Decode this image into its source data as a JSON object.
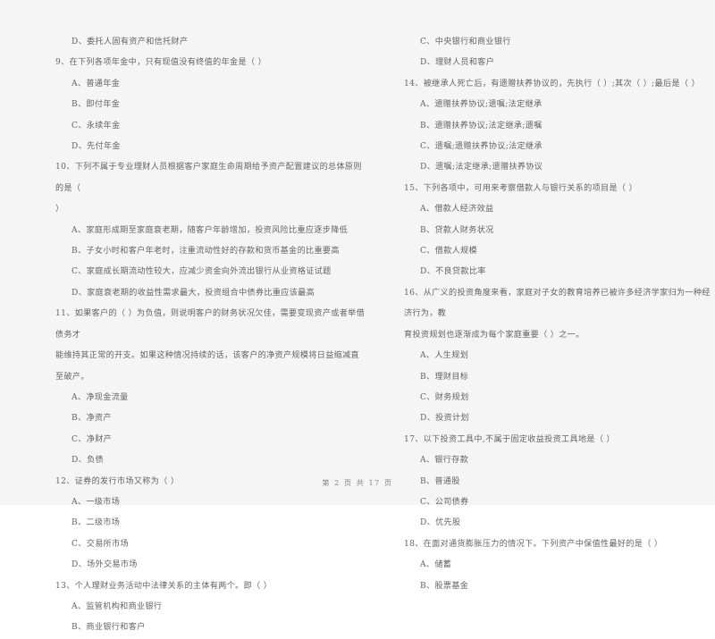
{
  "document": {
    "type": "scanned-exam-paper",
    "subject_hint": "银行从业资格证试题",
    "footer": "第 2 页  共 17 页",
    "ink_color": "#63615f",
    "paper_color": "#fefefe"
  },
  "columns": {
    "left": [
      {
        "kind": "option",
        "text": "D、委托人固有资产和信托财产"
      },
      {
        "kind": "question",
        "number": "9",
        "stem": "9、在下列各项年金中，只有现值没有终值的年金是（      ）",
        "options": [
          "A、普通年金",
          "B、即付年金",
          "C、永续年金",
          "D、先付年金"
        ]
      },
      {
        "kind": "question",
        "number": "10",
        "stem": "10、下列不属于专业理财人员根据客户家庭生命周期给予资产配置建议的总体原则的是（",
        "stem_cont": "）",
        "options": [
          "A、家庭形成期至家庭衰老期，随客户年龄增加，投资风险比重应逐步降低",
          "B、子女小时和客户年老时，注重流动性好的存款和货币基金的比重要高",
          "C、家庭成长期流动性较大，应减少资金向外流出银行从业资格证试题",
          "D、家庭衰老期的收益性需求最大，投资组合中债券比重应该最高"
        ]
      },
      {
        "kind": "question",
        "number": "11",
        "stem": "11、如果客户的（      ）为负值，则说明客户的财务状况欠佳，需要变现资产或者举借债务才",
        "stem_cont": "能维持其正常的开支。如果这种情况持续的话，该客户的净资产规模将日益缩减直至破产。",
        "options": [
          "A、净现金流量",
          "B、净资产",
          "C、净财产",
          "D、负债"
        ]
      },
      {
        "kind": "question",
        "number": "12",
        "stem": "12、证券的发行市场又称为（      ）",
        "options": [
          "A、一级市场",
          "B、二级市场",
          "C、交易所市场",
          "D、场外交易市场"
        ]
      },
      {
        "kind": "question",
        "number": "13",
        "stem": "13、个人理财业务活动中法律关系的主体有两个。即（      ）",
        "options": [
          "A、监管机构和商业银行",
          "B、商业银行和客户"
        ]
      }
    ],
    "right": [
      {
        "kind": "option",
        "text": "C、中央银行和商业银行"
      },
      {
        "kind": "option",
        "text": "D、理财人员和客户"
      },
      {
        "kind": "question",
        "number": "14",
        "stem": "14、被继承人死亡后，有遗赠扶养协议的，先执行（      ）;其次（      ）;最后是（      ）",
        "options": [
          "A、遗赠扶养协议;遗嘱;法定继承",
          "B、遗赠扶养协议;法定继承;遗嘱",
          "C、遗嘱;遗赠扶养协议;法定继承",
          "D、遗嘱;法定继承;遗赠扶养协议"
        ]
      },
      {
        "kind": "question",
        "number": "15",
        "stem": "15、下列各项中，可用来考察借款人与银行关系的项目是（      ）",
        "options": [
          "A、借款人经济效益",
          "B、贷款人财务状况",
          "C、借款人规模",
          "D、不良贷款比率"
        ]
      },
      {
        "kind": "question",
        "number": "16",
        "stem": "16、从广义的投资角度来看，家庭对子女的教育培养已被许多经济学家归为一种经济行为，教",
        "stem_cont": "育投资规划也逐渐成为每个家庭重要（      ）之一。",
        "options": [
          "A、人生规划",
          "B、理财目标",
          "C、财务规划",
          "D、投资计划"
        ]
      },
      {
        "kind": "question",
        "number": "17",
        "stem": "17、以下投资工具中,不属于固定收益投资工具地是（      ）",
        "options": [
          "A、银行存款",
          "B、普通股",
          "C、公司债券",
          "D、优先股"
        ]
      },
      {
        "kind": "question",
        "number": "18",
        "stem": "18、在面对通货膨胀压力的情况下。下列资产中保值性最好的是（      ）",
        "options": [
          "A、储蓄",
          "B、股票基金"
        ]
      }
    ]
  }
}
